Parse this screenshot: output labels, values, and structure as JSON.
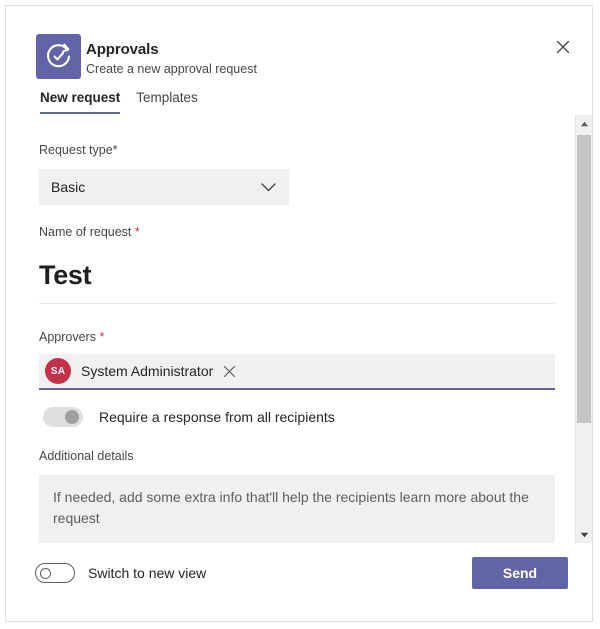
{
  "dialog": {
    "app_name": "Approvals",
    "app_subtitle": "Create a new approval request",
    "app_icon": "approvals-circular-arrow-check-icon",
    "close_icon": "close-icon",
    "accent_color": "#6264A7"
  },
  "tabs": [
    {
      "label": "New request",
      "active": true
    },
    {
      "label": "Templates",
      "active": false
    }
  ],
  "form": {
    "request_type": {
      "label": "Request type*",
      "value": "Basic",
      "chevron_icon": "chevron-down-icon"
    },
    "name_of_request": {
      "label": "Name of request ",
      "required_marker": "*",
      "value": "Test"
    },
    "approvers": {
      "label": "Approvers ",
      "required_marker": "*",
      "chips": [
        {
          "initials": "SA",
          "name": "System Administrator",
          "avatar_color": "#C4314B",
          "remove_icon": "close-icon"
        }
      ]
    },
    "require_response": {
      "label": "Require a response from all recipients",
      "state": "off"
    },
    "additional_details": {
      "label": "Additional details",
      "placeholder": "If needed, add some extra info that'll help the recipients learn more about the request",
      "value": ""
    }
  },
  "scrollbar": {
    "up_icon": "scroll-up-arrow-icon",
    "down_icon": "scroll-down-arrow-icon"
  },
  "footer": {
    "switch_view": {
      "label": "Switch to new view",
      "state": "off"
    },
    "send_label": "Send"
  }
}
